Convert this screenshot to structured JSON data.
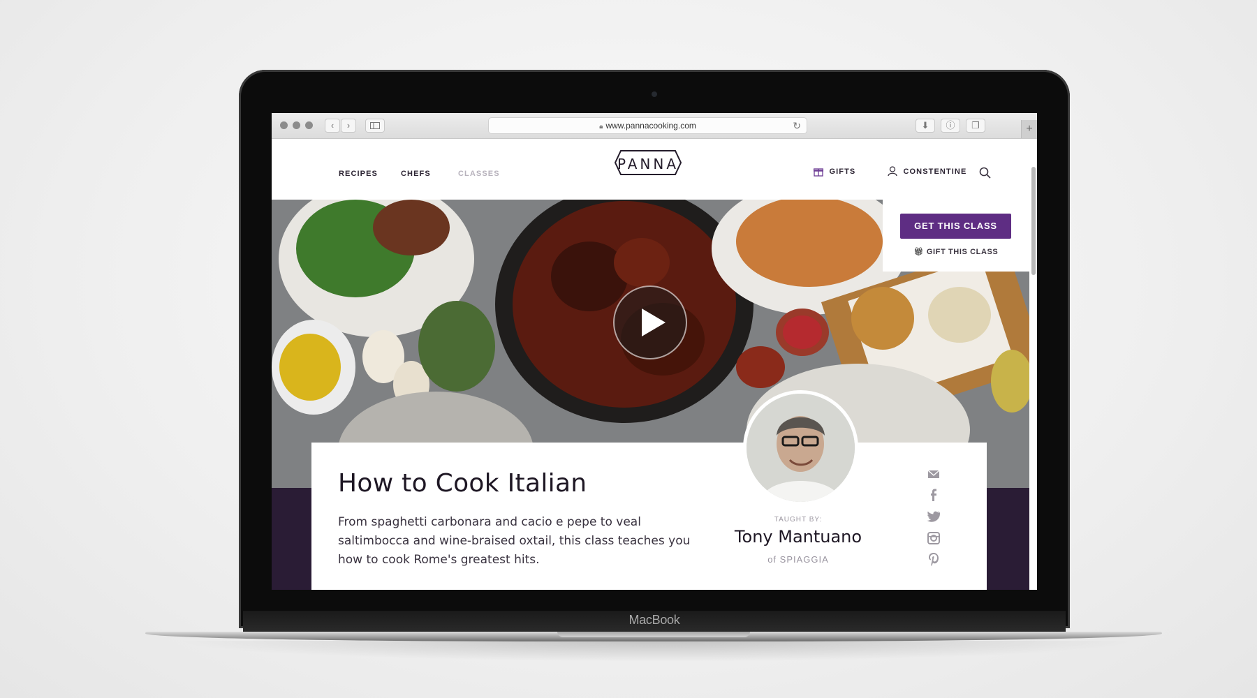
{
  "device": {
    "brand_label": "MacBook"
  },
  "browser": {
    "url": "www.pannacooking.com",
    "new_tab": "+"
  },
  "nav": {
    "links": [
      "RECIPES",
      "CHEFS",
      "CLASSES"
    ],
    "logo": "PANNA",
    "gifts_label": "GIFTS",
    "user_label": "CONSTENTINE"
  },
  "cta": {
    "primary_label": "GET THIS CLASS",
    "gift_label": "GIFT THIS CLASS"
  },
  "class": {
    "title": "How to Cook Italian",
    "description": "From spaghetti carbonara and cacio e pepe to veal saltimbocca and wine-braised oxtail, this class teaches you how to cook Rome's greatest hits."
  },
  "chef": {
    "taught_by_label": "TAUGHT BY:",
    "name": "Tony Mantuano",
    "restaurant_line": "of SPIAGGIA"
  },
  "social_icons": [
    "mail-icon",
    "facebook-icon",
    "twitter-icon",
    "instagram-icon",
    "pinterest-icon"
  ],
  "colors": {
    "accent_purple": "#5e2d83",
    "dark_band": "#2a1c35",
    "text_dark": "#1e1724"
  }
}
